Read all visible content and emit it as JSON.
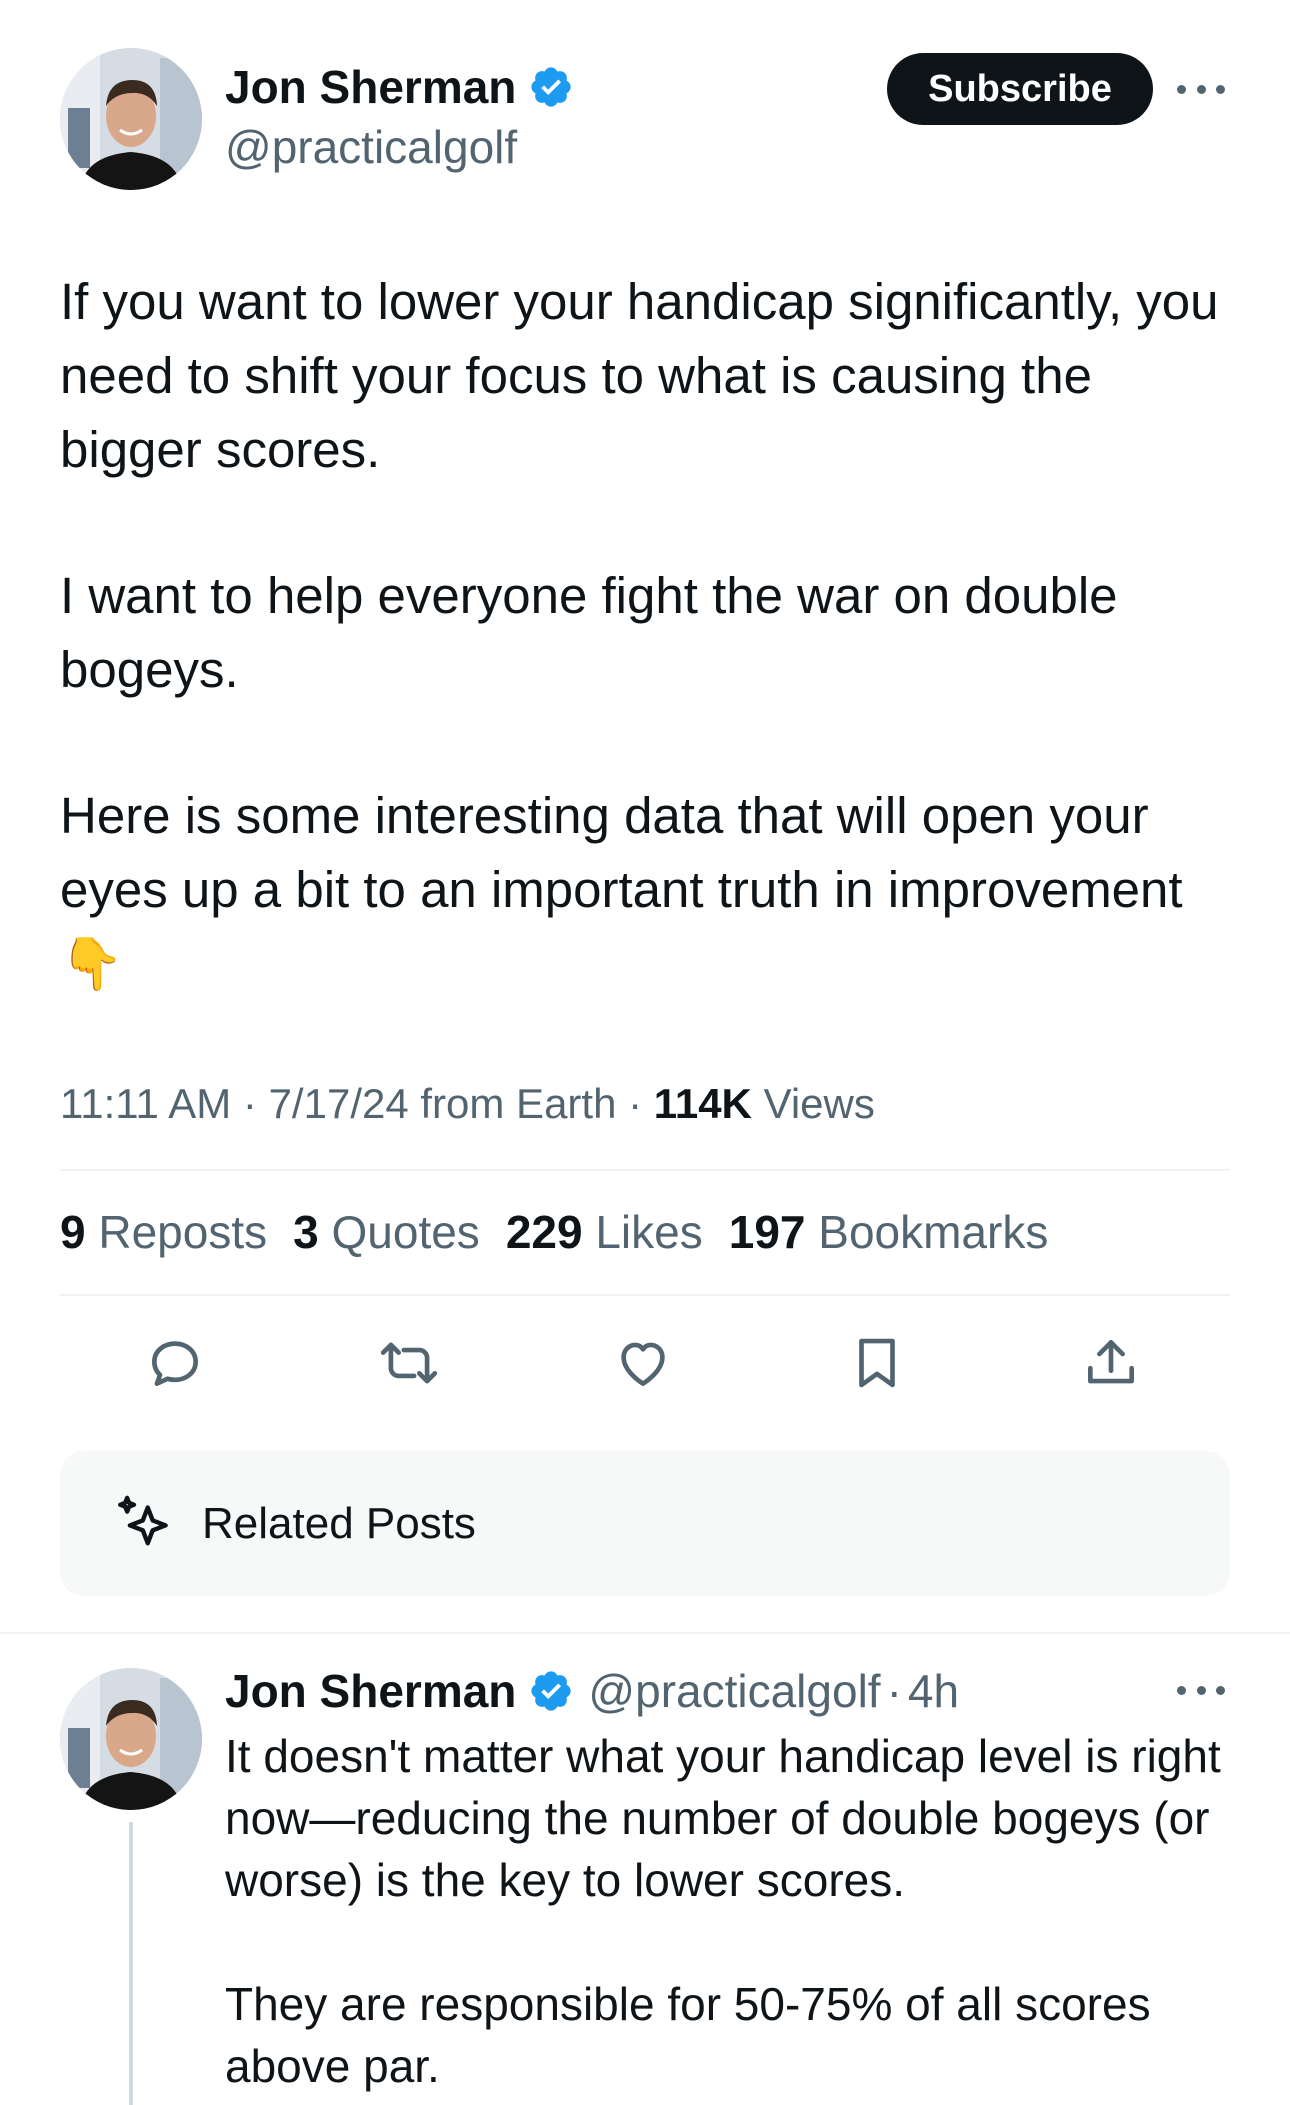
{
  "post": {
    "author": {
      "name": "Jon Sherman",
      "handle": "@practicalgolf",
      "verified": true
    },
    "subscribe_label": "Subscribe",
    "more_icon": "more-horizontal-icon",
    "text": [
      "If you want to lower your handicap significantly, you need to shift your focus to what is causing the bigger scores.",
      "I want to help everyone fight the war on double bogeys.",
      "Here is some interesting data that will open your eyes up a bit to an important truth in improvement 👇"
    ],
    "meta": {
      "time": "11:11 AM",
      "date": "7/17/24",
      "source": "from Earth",
      "separator": "·",
      "views_count": "114K",
      "views_label": "Views"
    },
    "stats": {
      "reposts_count": "9",
      "reposts_label": "Reposts",
      "quotes_count": "3",
      "quotes_label": "Quotes",
      "likes_count": "229",
      "likes_label": "Likes",
      "bookmarks_count": "197",
      "bookmarks_label": "Bookmarks"
    },
    "actions": [
      "reply-icon",
      "repost-icon",
      "like-icon",
      "bookmark-icon",
      "share-icon"
    ]
  },
  "related_posts": {
    "label": "Related Posts",
    "icon": "sparkle-icon"
  },
  "reply": {
    "author": {
      "name": "Jon Sherman",
      "handle": "@practicalgolf",
      "verified": true
    },
    "separator": "·",
    "time_ago": "4h",
    "text": [
      "It doesn't matter what your handicap level is right now—reducing the number of double bogeys (or worse) is the key to lower scores.",
      "They are responsible for 50-75% of all scores above par."
    ]
  },
  "colors": {
    "text_primary": "#0f1419",
    "text_secondary": "#536471",
    "verified_blue": "#1d9bf0",
    "divider": "#eff3f4",
    "card_bg": "#f7f9f9"
  }
}
